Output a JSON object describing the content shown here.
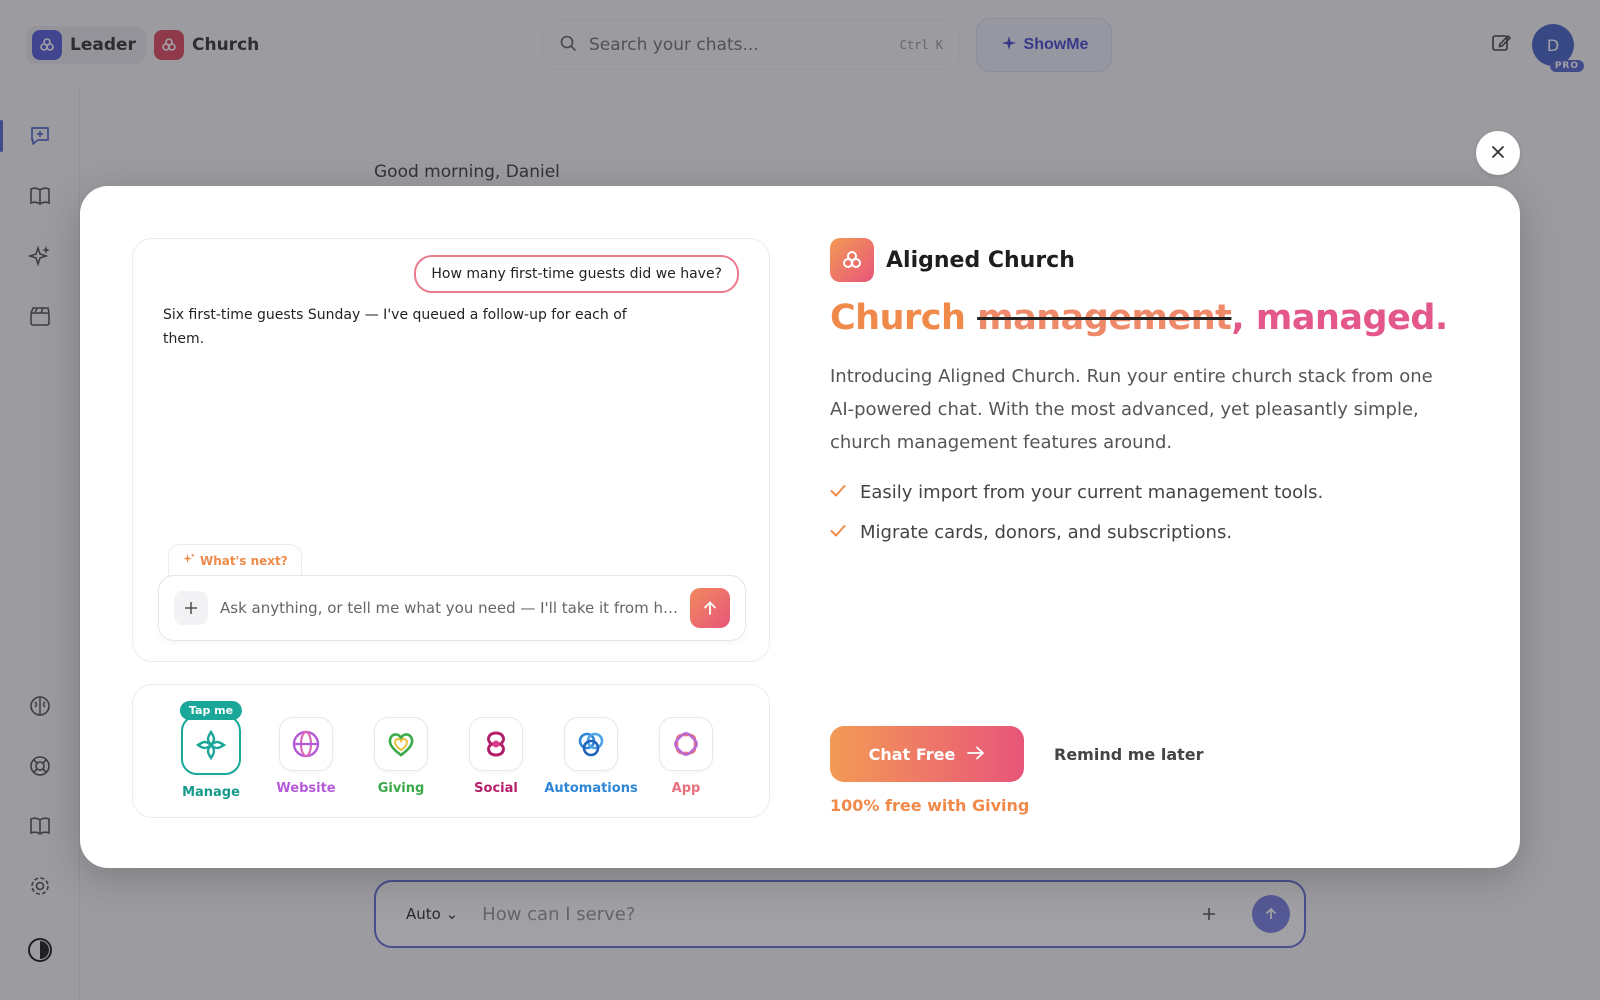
{
  "topbar": {
    "workspaces": [
      {
        "label": "Leader",
        "icon": "leader-logo-icon",
        "color": "#5b5fd8"
      },
      {
        "label": "Church",
        "icon": "church-logo-icon",
        "color": "#e04d62"
      }
    ],
    "search": {
      "placeholder": "Search your chats...",
      "shortcut": "Ctrl K"
    },
    "showme_label": "ShowMe",
    "avatar_initial": "D",
    "plan_badge": "PRO"
  },
  "sidenav": {
    "top_icons": [
      "new-chat-icon",
      "library-icon",
      "sparkles-icon",
      "clapperboard-icon"
    ],
    "bottom_icons": [
      "brain-icon",
      "help-lifebuoy-icon",
      "docs-book-icon",
      "settings-gear-icon",
      "theme-toggle-icon"
    ]
  },
  "background": {
    "greeting": "Good morning, Daniel",
    "composer": {
      "mode": "Auto",
      "placeholder": "How can I serve?"
    }
  },
  "modal": {
    "demo": {
      "user_message": "How many first-time guests did we have?",
      "assistant_message": "Six first-time guests Sunday — I've queued a follow-up for each of them.",
      "whats_next_label": "What's next?",
      "input_placeholder": "Ask anything, or tell me what you need — I'll take it from here."
    },
    "features": [
      {
        "label": "Manage",
        "color": "#169a8c",
        "icon": "manage-icon",
        "active": true,
        "badge": "Tap me"
      },
      {
        "label": "Website",
        "color": "#b55ad9",
        "icon": "website-globe-icon"
      },
      {
        "label": "Giving",
        "color": "#3aa94a",
        "icon": "giving-heart-icon"
      },
      {
        "label": "Social",
        "color": "#b51e6a",
        "icon": "social-knot-icon"
      },
      {
        "label": "Automations",
        "color": "#2e86d6",
        "icon": "automations-rings-icon"
      },
      {
        "label": "App",
        "color": "#e8707e",
        "icon": "app-flower-icon"
      }
    ],
    "brand_name": "Aligned Church",
    "headline": {
      "word1": "Church",
      "word2_struck": "management",
      "word3": ", managed."
    },
    "intro": "Introducing Aligned Church. Run your entire church stack from one AI-powered chat. With the most advanced, yet pleasantly simple, church management features around.",
    "bullets": [
      "Easily import from your current management tools.",
      "Migrate cards, donors, and subscriptions."
    ],
    "cta_label": "Chat Free",
    "remind_label": "Remind me later",
    "free_note": "100% free with Giving",
    "accent_colors": {
      "orange": "#f08a4a",
      "pink": "#e4578a"
    }
  }
}
